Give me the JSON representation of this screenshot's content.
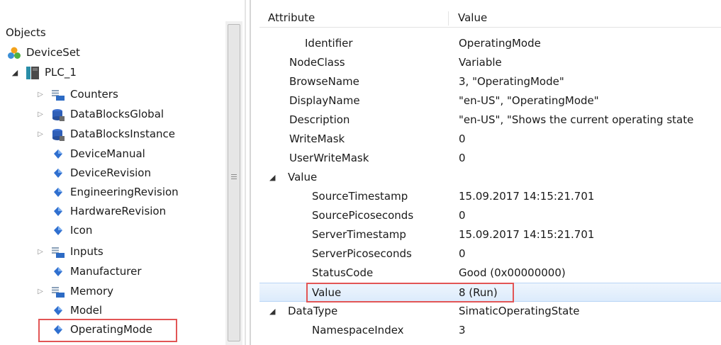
{
  "tree": {
    "root_label": "Objects",
    "items": [
      {
        "label": "DeviceSet",
        "icon": "deviceset-icon",
        "expander": ""
      },
      {
        "label": "PLC_1",
        "icon": "plc-icon",
        "expander": "open"
      },
      {
        "label": "Counters",
        "icon": "folder-tag-icon",
        "expander": "closed"
      },
      {
        "label": "DataBlocksGlobal",
        "icon": "datablock-icon",
        "expander": "closed"
      },
      {
        "label": "DataBlocksInstance",
        "icon": "datablock-icon",
        "expander": "closed"
      },
      {
        "label": "DeviceManual",
        "icon": "variable-icon",
        "expander": ""
      },
      {
        "label": "DeviceRevision",
        "icon": "variable-icon",
        "expander": ""
      },
      {
        "label": "EngineeringRevision",
        "icon": "variable-icon",
        "expander": ""
      },
      {
        "label": "HardwareRevision",
        "icon": "variable-icon",
        "expander": ""
      },
      {
        "label": "Icon",
        "icon": "variable-icon",
        "expander": ""
      },
      {
        "label": "Inputs",
        "icon": "folder-tag-icon",
        "expander": "closed"
      },
      {
        "label": "Manufacturer",
        "icon": "variable-icon",
        "expander": ""
      },
      {
        "label": "Memory",
        "icon": "folder-tag-icon",
        "expander": "closed"
      },
      {
        "label": "Model",
        "icon": "variable-icon",
        "expander": ""
      },
      {
        "label": "OperatingMode",
        "icon": "variable-icon",
        "expander": ""
      }
    ]
  },
  "attributes": {
    "col_attribute": "Attribute",
    "col_value": "Value",
    "rows": [
      {
        "name": "Identifier",
        "value": "OperatingMode"
      },
      {
        "name": "NodeClass",
        "value": "Variable"
      },
      {
        "name": "BrowseName",
        "value": "3, \"OperatingMode\""
      },
      {
        "name": "DisplayName",
        "value": "\"en-US\", \"OperatingMode\""
      },
      {
        "name": "Description",
        "value": "\"en-US\", \"Shows the current operating state"
      },
      {
        "name": "WriteMask",
        "value": "0"
      },
      {
        "name": "UserWriteMask",
        "value": "0"
      },
      {
        "name": "Value",
        "value": ""
      },
      {
        "name": "SourceTimestamp",
        "value": "15.09.2017 14:15:21.701"
      },
      {
        "name": "SourcePicoseconds",
        "value": "0"
      },
      {
        "name": "ServerTimestamp",
        "value": "15.09.2017 14:15:21.701"
      },
      {
        "name": "ServerPicoseconds",
        "value": "0"
      },
      {
        "name": "StatusCode",
        "value": "Good (0x00000000)"
      },
      {
        "name": "Value",
        "value": "8 (Run)"
      },
      {
        "name": "DataType",
        "value": "SimaticOperatingState"
      },
      {
        "name": "NamespaceIndex",
        "value": "3"
      }
    ]
  },
  "colors": {
    "highlight": "#e25555",
    "selection": "#dcebfc",
    "variable_icon": "#2f6fcf"
  }
}
